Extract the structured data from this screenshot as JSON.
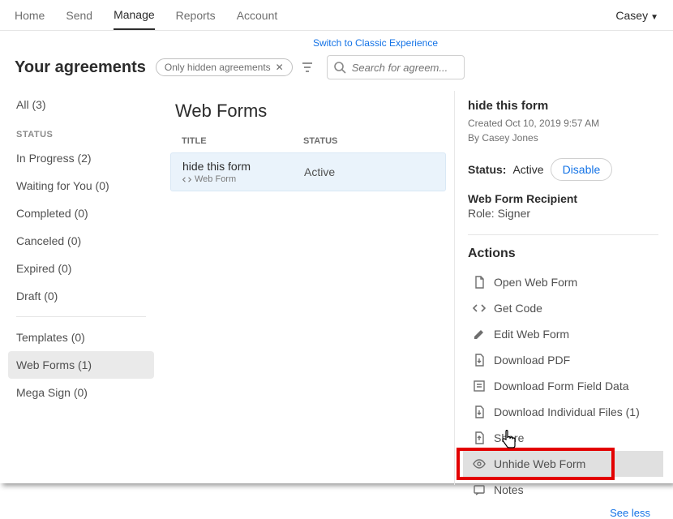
{
  "nav": {
    "items": [
      "Home",
      "Send",
      "Manage",
      "Reports",
      "Account"
    ],
    "active": 2,
    "user": "Casey"
  },
  "switch_link": "Switch to Classic Experience",
  "header": {
    "title": "Your agreements",
    "chip": "Only hidden agreements",
    "search_placeholder": "Search for agreem..."
  },
  "sidebar": {
    "all": "All (3)",
    "status_heading": "STATUS",
    "status_items": [
      "In Progress (2)",
      "Waiting for You (0)",
      "Completed (0)",
      "Canceled (0)",
      "Expired (0)",
      "Draft (0)"
    ],
    "type_items": [
      "Templates (0)",
      "Web Forms (1)",
      "Mega Sign (0)"
    ],
    "selected_type": 1
  },
  "center": {
    "heading": "Web Forms",
    "cols": {
      "title": "TITLE",
      "status": "STATUS"
    },
    "rows": [
      {
        "name": "hide this form",
        "subtype": "Web Form",
        "status": "Active"
      }
    ]
  },
  "details": {
    "title": "hide this form",
    "created": "Created Oct 10, 2019 9:57 AM",
    "by": "By Casey Jones",
    "status_label": "Status:",
    "status_value": "Active",
    "disable": "Disable",
    "recipient_label": "Web Form Recipient",
    "role": "Role: Signer",
    "actions_heading": "Actions",
    "actions": [
      {
        "icon": "doc",
        "label": "Open Web Form"
      },
      {
        "icon": "code",
        "label": "Get Code"
      },
      {
        "icon": "pencil",
        "label": "Edit Web Form"
      },
      {
        "icon": "pdf",
        "label": "Download PDF"
      },
      {
        "icon": "download",
        "label": "Download Form Field Data"
      },
      {
        "icon": "files",
        "label": "Download Individual Files (1)"
      },
      {
        "icon": "share",
        "label": "Share"
      },
      {
        "icon": "eye",
        "label": "Unhide Web Form"
      },
      {
        "icon": "note",
        "label": "Notes"
      }
    ],
    "see_less": "See less"
  }
}
